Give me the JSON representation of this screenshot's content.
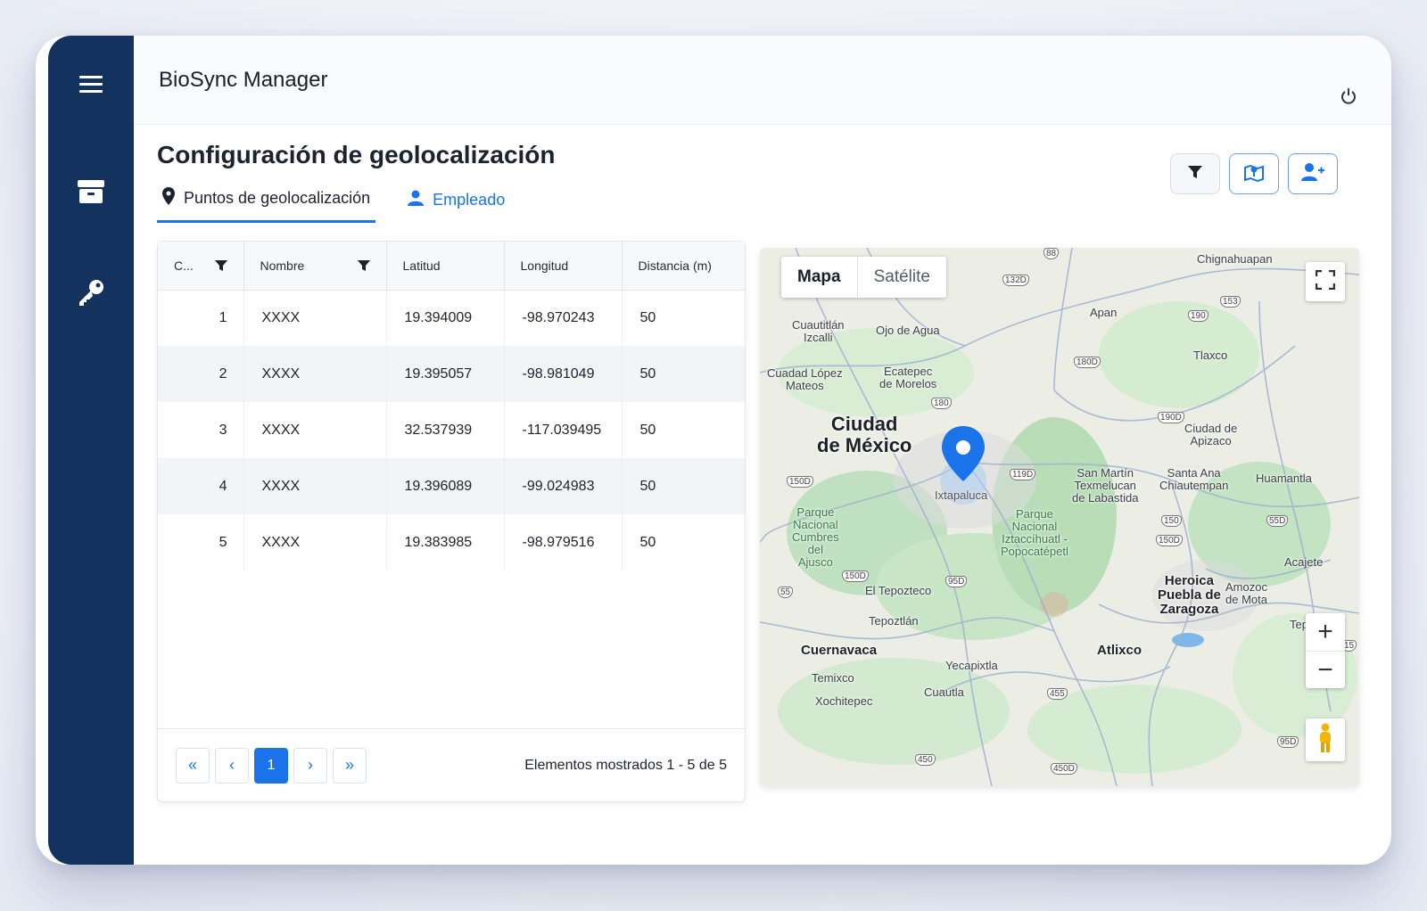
{
  "app": {
    "title": "BioSync Manager"
  },
  "page": {
    "title": "Configuración de geolocalización"
  },
  "tabs": [
    {
      "label": "Puntos de geolocalización",
      "icon": "map-pin-icon",
      "active": true
    },
    {
      "label": "Empleado",
      "icon": "user-icon",
      "active": false
    }
  ],
  "table": {
    "columns": [
      "C...",
      "Nombre",
      "Latitud",
      "Longitud",
      "Distancia (m)"
    ],
    "rows": [
      {
        "id": "1",
        "nombre": "XXXX",
        "latitud": "19.394009",
        "longitud": "-98.970243",
        "distancia": "50"
      },
      {
        "id": "2",
        "nombre": "XXXX",
        "latitud": "19.395057",
        "longitud": "-98.981049",
        "distancia": "50"
      },
      {
        "id": "3",
        "nombre": "XXXX",
        "latitud": "32.537939",
        "longitud": "-117.039495",
        "distancia": "50"
      },
      {
        "id": "4",
        "nombre": "XXXX",
        "latitud": "19.396089",
        "longitud": "-99.024983",
        "distancia": "50"
      },
      {
        "id": "5",
        "nombre": "XXXX",
        "latitud": "19.383985",
        "longitud": "-98.979516",
        "distancia": "50"
      }
    ]
  },
  "pager": {
    "first": "«",
    "prev": "‹",
    "current": "1",
    "next": "›",
    "last": "»",
    "info": "Elementos mostrados 1 - 5 de 5"
  },
  "map": {
    "type_map": "Mapa",
    "type_satellite": "Satélite",
    "zoom_in": "+",
    "zoom_out": "−",
    "marker_label": "Ixtapaluca",
    "places": {
      "chignahuapan": "Chignahuapan",
      "cuautitlan": "Cuautitlán\nIzcalli",
      "ojo_agua": "Ojo de Agua",
      "apan": "Apan",
      "cuadad_lopez": "Cuadad López\nMateos",
      "ecatepec": "Ecatepec\nde Morelos",
      "tlaxco": "Tlaxco",
      "cdmx": "Ciudad\nde México",
      "ciudad_apizaco": "Ciudad de\nApizaco",
      "san_martin": "San Martín\nTexmelucan\nde Labastida",
      "santa_ana": "Santa Ana\nChiautempan",
      "huamantla": "Huamantla",
      "pn_cumbres": "Parque\nNacional\nCumbres\ndel\nAjusco",
      "pn_izta": "Parque\nNacional\nIztaccíhuatl -\nPopocatépetl",
      "acajete": "Acajete",
      "tepozteco": "El Tepozteco",
      "heroica": "Heroica\nPuebla de\nZaragoza",
      "amozoc": "Amozoc\nde Mota",
      "tepoztlan": "Tepoztlán",
      "tepeaca": "Tepeaca",
      "cuernavaca": "Cuernavaca",
      "atlixco": "Atlixco",
      "yecapixtla": "Yecapixtla",
      "temixco": "Temixco",
      "cuautla": "Cuautla",
      "xochitepec": "Xochitepec"
    },
    "shields": [
      "88",
      "132D",
      "190",
      "153",
      "180D",
      "190D",
      "180",
      "150D",
      "119D",
      "150",
      "150D",
      "55D",
      "150D",
      "55",
      "95D",
      "455",
      "95D",
      "450",
      "450D",
      "15"
    ]
  },
  "colors": {
    "sidebar": "#13325e",
    "accent": "#1a73e8"
  }
}
